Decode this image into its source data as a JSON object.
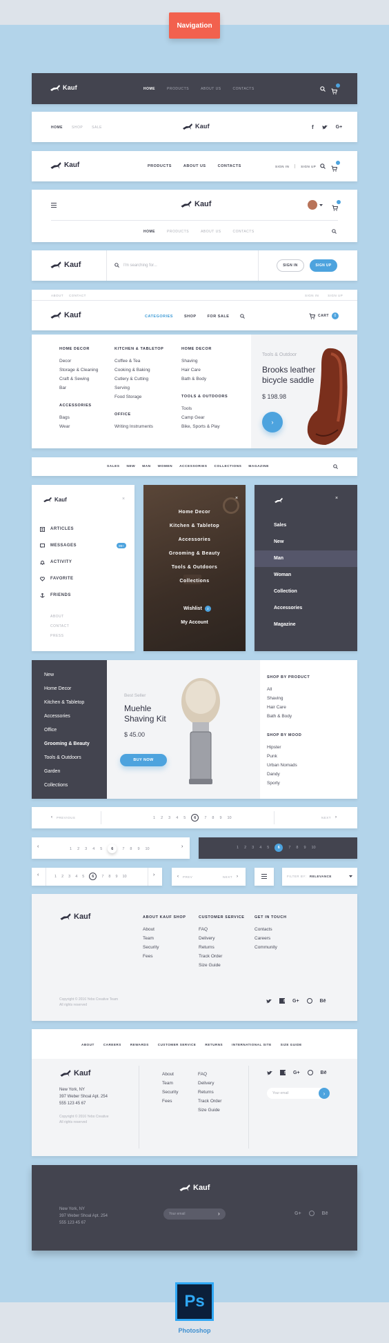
{
  "title": "Navigation",
  "brand": "Kauf",
  "header1": {
    "items": [
      "HOME",
      "PRODUCTS",
      "ABOUT US",
      "CONTACTS"
    ]
  },
  "header2": {
    "items": [
      "HOME",
      "SHOP",
      "SALE"
    ]
  },
  "header3": {
    "items": [
      "PRODUCTS",
      "ABOUT US",
      "CONTACTS"
    ],
    "sign_in": "SIGN IN",
    "sign_up": "SIGN UP"
  },
  "header4": {
    "items": [
      "HOME",
      "PRODUCTS",
      "ABOUT US",
      "CONTACTS"
    ]
  },
  "header5": {
    "search_placeholder": "I'm searching for...",
    "sign_in": "SIGN IN",
    "sign_up": "SIGN UP"
  },
  "header6": {
    "top_left": [
      "ABOUT",
      "CONTACT"
    ],
    "top_right": [
      "SIGN IN",
      "SIGN UP"
    ],
    "items": [
      "CATEGORIES",
      "SHOP",
      "FOR SALE"
    ],
    "cart": "CART",
    "cart_count": "0"
  },
  "mega": {
    "col1_title": "HOME DECOR",
    "col1": [
      "Decor",
      "Storage & Cleaning",
      "Craft & Sewing",
      "Bar"
    ],
    "col1b_title": "ACCESSORIES",
    "col1b": [
      "Bags",
      "Wear"
    ],
    "col2_title": "KITCHEN & TABLETOP",
    "col2": [
      "Coffee & Tea",
      "Cooking & Baking",
      "Cutlery & Cutting",
      "Serving",
      "Food Storage"
    ],
    "col2b_title": "OFFICE",
    "col2b": [
      "Writing Instruments"
    ],
    "col3_title": "HOME DECOR",
    "col3": [
      "Shaving",
      "Hair Care",
      "Bath & Body"
    ],
    "col3b_title": "TOOLS & OUTDOORS",
    "col3b": [
      "Tools",
      "Camp Gear",
      "Bike, Sports & Play"
    ],
    "promo_kicker": "Tools & Outdoor",
    "promo_title_1": "Brooks leather",
    "promo_title_2": "bicycle saddle",
    "promo_price": "$ 198.98"
  },
  "catbar": {
    "items": [
      "SALES",
      "NEW",
      "MAN",
      "WOMEN",
      "ACCESSORIES",
      "COLLECTIONS",
      "MAGAZINE"
    ]
  },
  "side1": {
    "items": [
      "ARTICLES",
      "MESSAGES",
      "ACTIVITY",
      "FAVORITE",
      "FRIENDS"
    ],
    "messages_count": "99+",
    "footer": [
      "ABOUT",
      "CONTACT",
      "PRESS"
    ]
  },
  "side2": {
    "items": [
      "Home Decor",
      "Kitchen & Tabletop",
      "Accessories",
      "Grooming & Beauty",
      "Tools & Outdoors",
      "Collections"
    ],
    "wishlist": "Wishlist",
    "wishlist_count": "3",
    "account": "My Account"
  },
  "side3": {
    "items": [
      "Sales",
      "New",
      "Man",
      "Woman",
      "Collection",
      "Accessories",
      "Magazine"
    ]
  },
  "big": {
    "left": [
      "New",
      "Home Decor",
      "Kitchen & Tabletop",
      "Accessories",
      "Office",
      "Grooming & Beauty",
      "Tools & Outdoors",
      "Garden",
      "Collections"
    ],
    "kicker": "Best Seller",
    "title_1": "Muehle",
    "title_2": "Shaving Kit",
    "price": "$ 45.00",
    "buy": "BUY NOW",
    "r1_title": "SHOP BY PRODUCT",
    "r1": [
      "All",
      "Shaving",
      "Hair Care",
      "Bath & Body"
    ],
    "r2_title": "SHOP BY MOOD",
    "r2": [
      "Hipster",
      "Punk",
      "Urban Nomads",
      "Dandy",
      "Sporty"
    ]
  },
  "pag": {
    "pages": [
      "1",
      "2",
      "3",
      "4",
      "5",
      "6",
      "7",
      "8",
      "9",
      "10"
    ],
    "active": "6",
    "previous": "PREVIOUS",
    "next": "NEXT",
    "prev_short": "PREV",
    "filter_by": "FILTER BY:",
    "relevance": "RELEVANCE"
  },
  "footer1": {
    "c1_title": "ABOUT KAUF SHOP",
    "c1": [
      "About",
      "Team",
      "Security",
      "Fees"
    ],
    "c2_title": "CUSTOMER SERVICE",
    "c2": [
      "FAQ",
      "Delivery",
      "Returns",
      "Track Order",
      "Size Guide"
    ],
    "c3_title": "GET IN TOUCH",
    "c3": [
      "Contacts",
      "Careers",
      "Community"
    ],
    "copy_1": "Copyright © 2016 Yebo Creative Team",
    "copy_2": "All rights reserved"
  },
  "footer2": {
    "top": [
      "ABOUT",
      "CAREERS",
      "REWARDS",
      "CUSTOMER SERVICE",
      "RETURNS",
      "INTERNATIONAL SITE",
      "SIZE GUIDE"
    ],
    "addr": [
      "New York, NY",
      "397 Weber Shoal Apt. 254",
      "555 123 45 67"
    ],
    "copy_1": "Copyright © 2016 Yebo Creative",
    "copy_2": "All rights reserved",
    "c1": [
      "About",
      "Team",
      "Security",
      "Fees"
    ],
    "c2": [
      "FAQ",
      "Delivery",
      "Returns",
      "Track Order",
      "Size Guide"
    ],
    "email_placeholder": "Your email"
  },
  "footer3": {
    "addr": [
      "New York, NY",
      "397 Weber Shoal Apt. 254",
      "555 123 45 67"
    ],
    "email_placeholder": "Your email"
  },
  "photoshop": "Photoshop",
  "ps": "Ps",
  "social": {
    "behance": "Bē"
  },
  "colors": {
    "accent": "#4da3de",
    "dark": "#43444f",
    "pill": "#f2614e",
    "bg": "#b3d4ea"
  }
}
